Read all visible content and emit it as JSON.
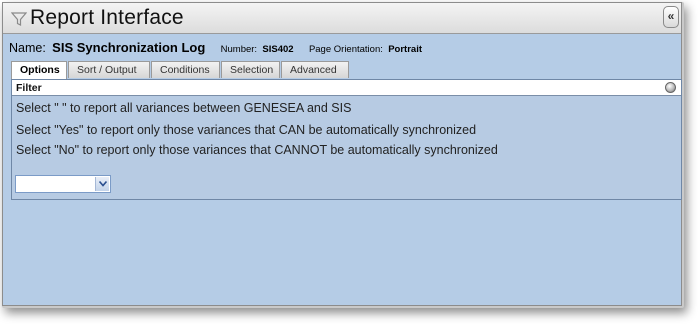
{
  "window": {
    "title": "Report Interface",
    "collapse_glyph": "«"
  },
  "report": {
    "name_label": "Name:",
    "name_value": "SIS Synchronization Log",
    "number_label": "Number:",
    "number_value": "SIS402",
    "orientation_label": "Page Orientation:",
    "orientation_value": "Portrait"
  },
  "tabs": [
    {
      "label": "Options",
      "active": true
    },
    {
      "label": "Sort / Output",
      "active": false
    },
    {
      "label": "Conditions",
      "active": false
    },
    {
      "label": "Selection",
      "active": false
    },
    {
      "label": "Advanced",
      "active": false
    }
  ],
  "filter": {
    "header": "Filter",
    "lines": [
      "Select \" \" to report all variances between GENESEA and SIS",
      "Select \"Yes\" to report only those variances that CAN be automatically synchronized",
      "Select \"No\" to report only those variances that CANNOT be automatically synchronized"
    ],
    "select_value": ""
  },
  "colors": {
    "panel_bg": "#b5cce6",
    "title_bar": "#e6e6e6",
    "select_border": "#7b9bc7"
  },
  "icons": {
    "title": "filter-funnel-icon",
    "collapse": "double-chevron-left-icon",
    "filter_toggle": "circle-toggle-icon",
    "select_arrow": "chevron-down-icon"
  }
}
